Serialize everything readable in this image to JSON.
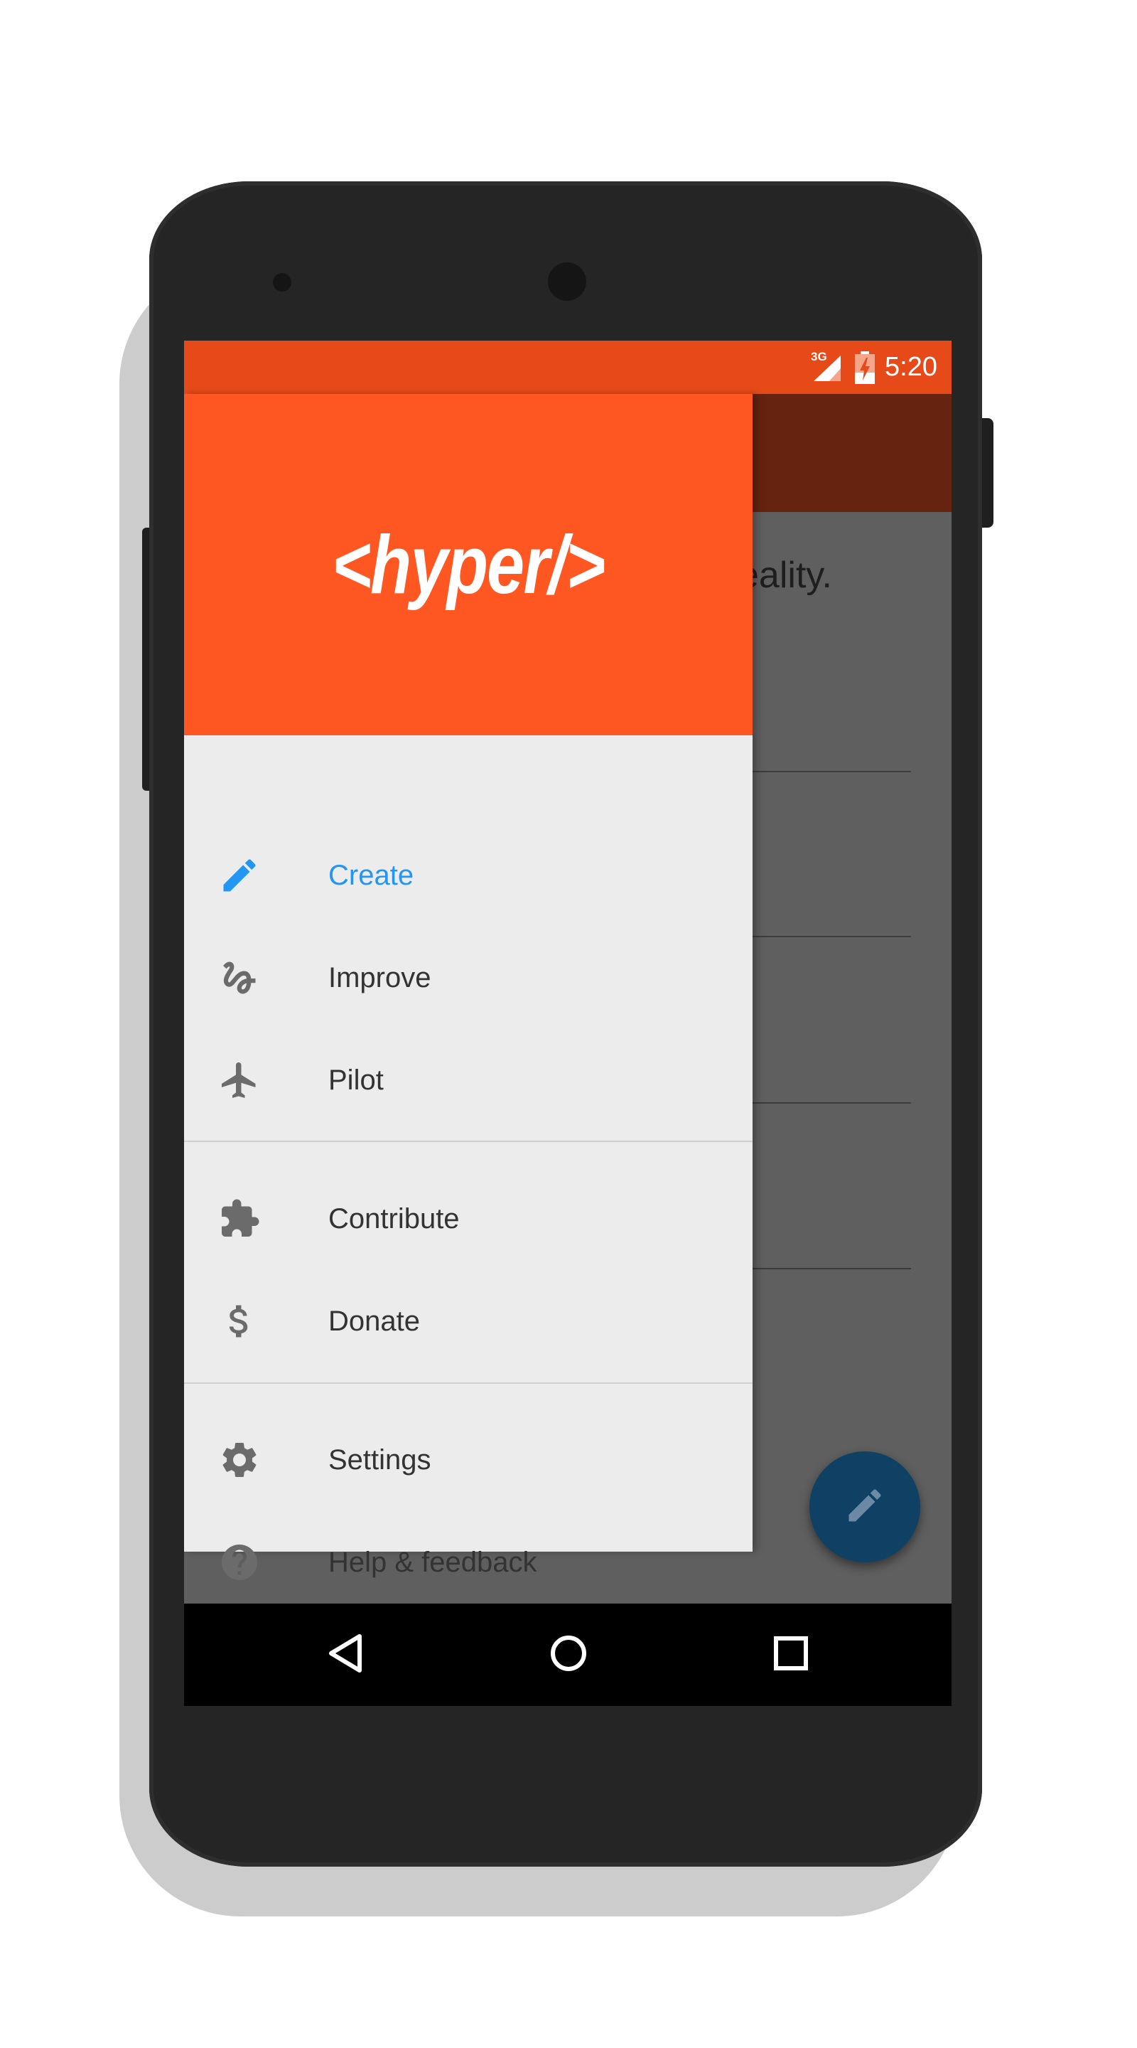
{
  "status_bar": {
    "network_label": "3G",
    "time": "5:20"
  },
  "drawer": {
    "logo": "<hyper/>",
    "groups": [
      [
        {
          "label": "Create",
          "icon": "pencil-icon",
          "active": true
        },
        {
          "label": "Improve",
          "icon": "gesture-icon",
          "active": false
        },
        {
          "label": "Pilot",
          "icon": "airplane-icon",
          "active": false
        }
      ],
      [
        {
          "label": "Contribute",
          "icon": "puzzle-icon",
          "active": false
        },
        {
          "label": "Donate",
          "icon": "dollar-icon",
          "active": false
        }
      ],
      [
        {
          "label": "Settings",
          "icon": "gear-icon",
          "active": false
        },
        {
          "label": "Help & feedback",
          "icon": "help-icon",
          "active": false
        }
      ]
    ]
  },
  "background": {
    "partial_text": "eality."
  },
  "colors": {
    "status_bar": "#e64a19",
    "drawer_header": "#ff5722",
    "active_item": "#2196f3",
    "fab": "#0f4165"
  }
}
